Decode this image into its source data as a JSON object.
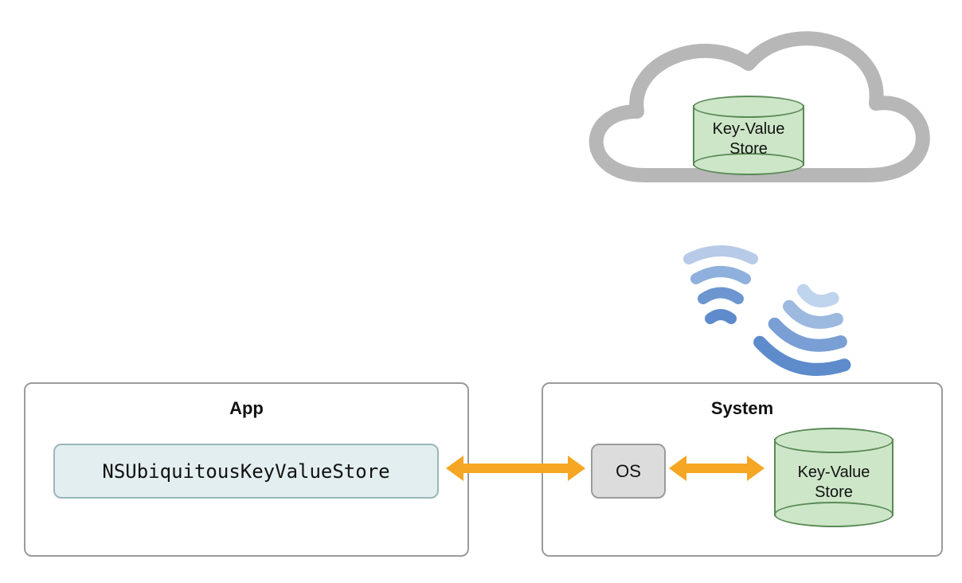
{
  "app": {
    "title": "App",
    "api_label": "NSUbiquitousKeyValueStore"
  },
  "system": {
    "title": "System",
    "os_label": "OS",
    "kv_label_line1": "Key-Value",
    "kv_label_line2": "Store"
  },
  "cloud": {
    "kv_label_line1": "Key-Value",
    "kv_label_line2": "Store"
  }
}
